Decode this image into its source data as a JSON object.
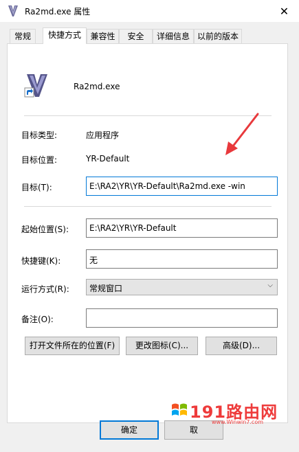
{
  "window": {
    "title": "Ra2md.exe 属性"
  },
  "tabs": [
    {
      "label": "常规",
      "active": false
    },
    {
      "label": "快捷方式",
      "active": true
    },
    {
      "label": "兼容性",
      "active": false
    },
    {
      "label": "安全",
      "active": false
    },
    {
      "label": "详细信息",
      "active": false
    },
    {
      "label": "以前的版本",
      "active": false
    }
  ],
  "shortcut": {
    "name": "Ra2md.exe",
    "target_type_label": "目标类型:",
    "target_type_value": "应用程序",
    "target_location_label": "目标位置:",
    "target_location_value": "YR-Default",
    "target_label": "目标(T):",
    "target_value": "E:\\RA2\\YR\\YR-Default\\Ra2md.exe -win",
    "start_in_label": "起始位置(S):",
    "start_in_value": "E:\\RA2\\YR\\YR-Default",
    "hotkey_label": "快捷键(K):",
    "hotkey_value": "无",
    "run_label": "运行方式(R):",
    "run_value": "常规窗口",
    "comment_label": "备注(O):",
    "comment_value": "",
    "open_location_button": "打开文件所在的位置(F)",
    "change_icon_button": "更改图标(C)...",
    "advanced_button": "高级(D)..."
  },
  "footer": {
    "ok_button": "确定",
    "cancel_partial": "取"
  },
  "watermark": {
    "main": "191路由网",
    "sub": "www.Winwin7.com"
  },
  "colors": {
    "accent": "#0078d7",
    "annotation_arrow": "#e8393c",
    "watermark": "#ee3b3b"
  },
  "icons": {
    "app": "ra2md-app-icon",
    "shortcut_overlay": "shortcut-arrow-icon",
    "close": "close-icon",
    "dropdown": "chevron-down-icon"
  }
}
